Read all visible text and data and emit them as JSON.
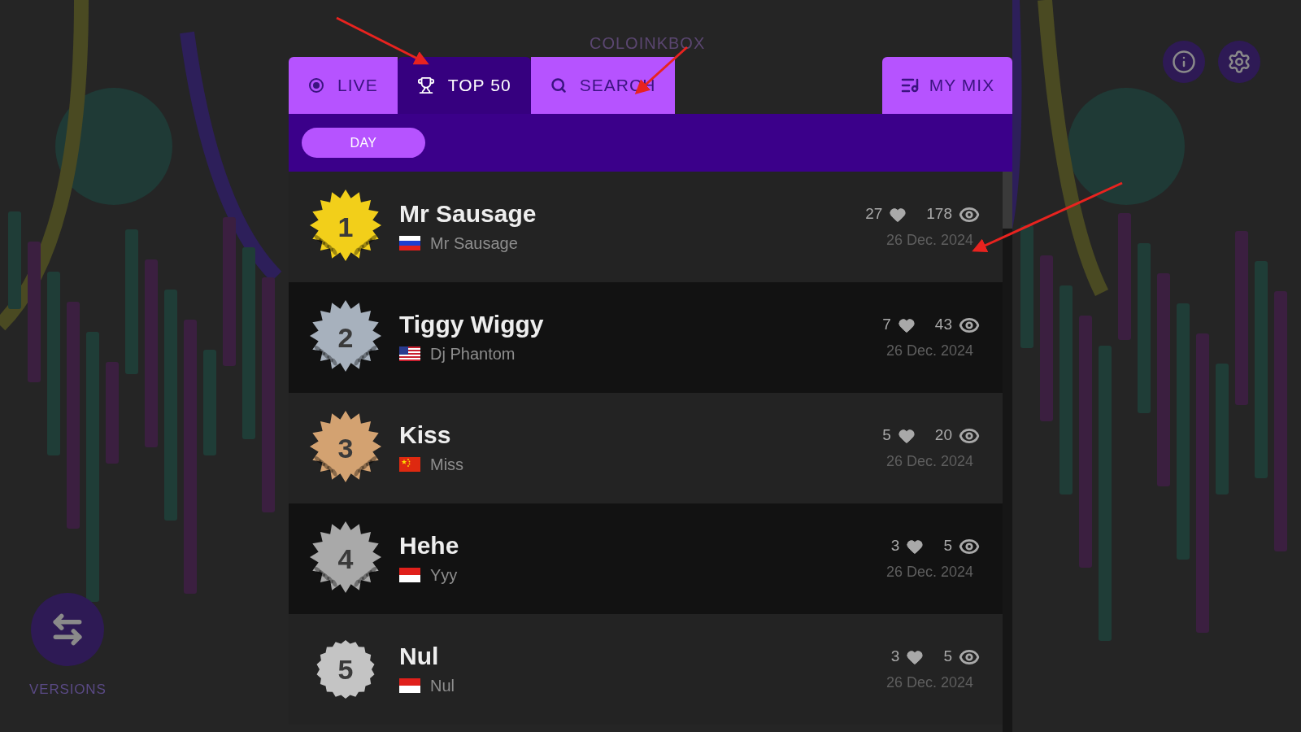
{
  "logo": "COLOINKBOX",
  "tabs": [
    {
      "label": "LIVE",
      "kind": "live",
      "selected": false
    },
    {
      "label": "TOP 50",
      "kind": "trophy",
      "selected": true
    },
    {
      "label": "SEARCH",
      "kind": "search",
      "selected": false
    }
  ],
  "my_mix": {
    "label": "MY MIX"
  },
  "filters": [
    {
      "label": "DAY",
      "selected": true
    }
  ],
  "rows": [
    {
      "rank": "1",
      "badge": {
        "color": "#f2cf1a",
        "laurel": true
      },
      "title": "Mr Sausage",
      "flag": {
        "kind": "ru"
      },
      "artist": "Mr Sausage",
      "likes": "27",
      "views": "178",
      "date": "26 Dec. 2024"
    },
    {
      "rank": "2",
      "badge": {
        "color": "#a7b1bd",
        "laurel": true
      },
      "title": "Tiggy Wiggy",
      "flag": {
        "kind": "us"
      },
      "artist": "Dj Phantom",
      "likes": "7",
      "views": "43",
      "date": "26 Dec. 2024"
    },
    {
      "rank": "3",
      "badge": {
        "color": "#d3a271",
        "laurel": true
      },
      "title": "Kiss",
      "flag": {
        "kind": "cn"
      },
      "artist": "Miss",
      "likes": "5",
      "views": "20",
      "date": "26 Dec. 2024"
    },
    {
      "rank": "4",
      "badge": {
        "color": "#a9a9a9",
        "laurel": true
      },
      "title": "Hehe",
      "flag": {
        "kind": "id"
      },
      "artist": "Yyy",
      "likes": "3",
      "views": "5",
      "date": "26 Dec. 2024"
    },
    {
      "rank": "5",
      "badge": {
        "color": "#c4c4c4",
        "laurel": false
      },
      "title": "Nul",
      "flag": {
        "kind": "id"
      },
      "artist": "Nul",
      "likes": "3",
      "views": "5",
      "date": "26 Dec. 2024"
    }
  ],
  "versions": {
    "label": "VERSIONS"
  }
}
